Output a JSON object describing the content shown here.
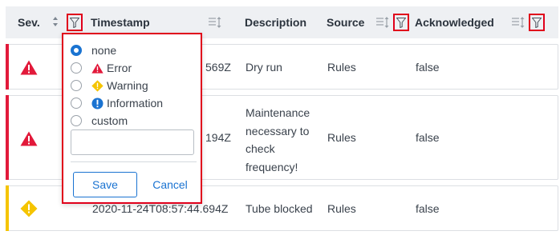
{
  "table": {
    "columns": {
      "severity": "Sev.",
      "timestamp": "Timestamp",
      "description": "Description",
      "source": "Source",
      "acknowledged": "Acknowledged"
    },
    "rows": [
      {
        "severity": "error",
        "timestamp_visible": "569Z",
        "description_lines": [
          "Dry run"
        ],
        "source": "Rules",
        "acknowledged": "false"
      },
      {
        "severity": "error",
        "timestamp_visible": "194Z",
        "description_lines": [
          "Maintenance",
          "necessary to",
          "check",
          "frequency!"
        ],
        "source": "Rules",
        "acknowledged": "false"
      },
      {
        "severity": "warning",
        "timestamp_visible": "2020-11-24T08:57:44.694Z",
        "description_lines": [
          "Tube blocked"
        ],
        "source": "Rules",
        "acknowledged": "false"
      }
    ]
  },
  "filter_popup": {
    "options": [
      {
        "label": "none",
        "icon": "",
        "selected": true
      },
      {
        "label": "Error",
        "icon": "error-triangle-icon",
        "selected": false
      },
      {
        "label": "Warning",
        "icon": "warning-diamond-icon",
        "selected": false
      },
      {
        "label": "Information",
        "icon": "info-circle-icon",
        "selected": false
      },
      {
        "label": "custom",
        "icon": "",
        "selected": false
      }
    ],
    "custom_value": "",
    "save_label": "Save",
    "cancel_label": "Cancel"
  },
  "colors": {
    "error": "#e2193a",
    "warning": "#f5c400",
    "info": "#1a73d1",
    "highlight": "#e0001b",
    "header_bg": "#eef0f3"
  }
}
